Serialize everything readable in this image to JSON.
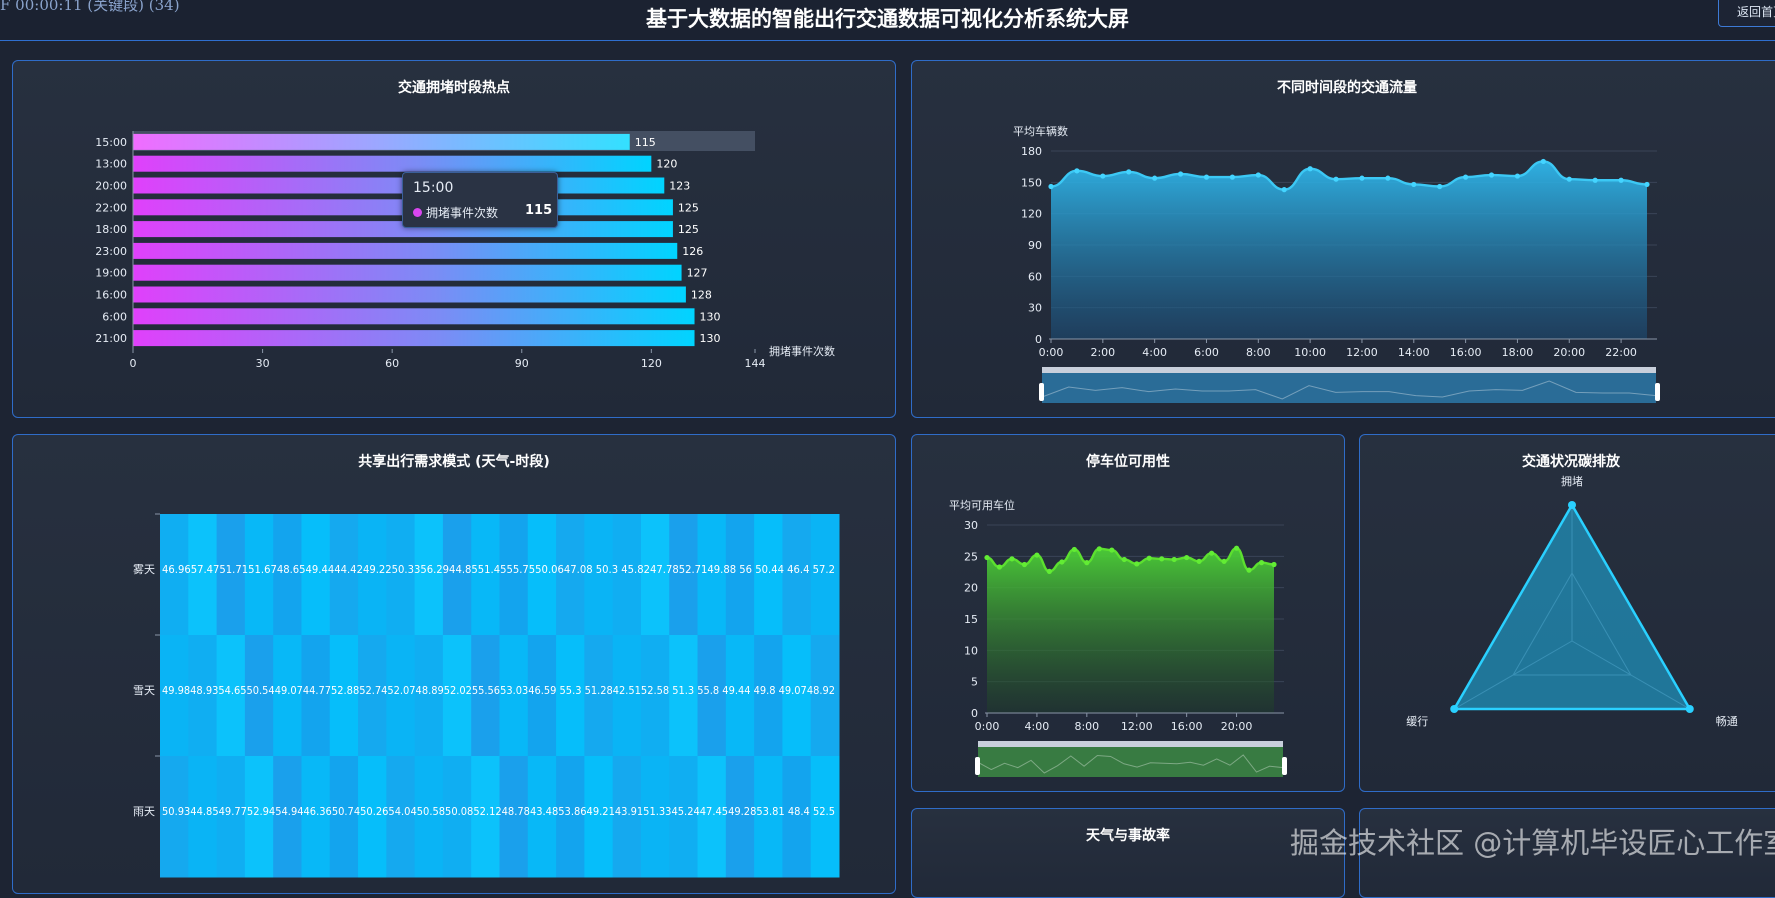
{
  "header": {
    "clock": "F 00:00:11 (关键段) (34)",
    "title": "基于大数据的智能出行交通数据可视化分析系统大屏",
    "back_label": "返回首页"
  },
  "panels": {
    "congestion": "交通拥堵时段热点",
    "flow": "不同时间段的交通流量",
    "sharing": "共享出行需求模式 (天气-时段)",
    "parking": "停车位可用性",
    "emission": "交通状况碳排放",
    "weather": "天气与事故率"
  },
  "tooltip": {
    "time": "15:00",
    "label": "拥堵事件次数",
    "value": "115"
  },
  "watermark": "掘金技术社区 @计算机毕设匠心工作室",
  "chart_data": [
    {
      "id": "congestion",
      "type": "bar",
      "title": "交通拥堵时段热点",
      "orientation": "horizontal",
      "categories": [
        "15:00",
        "13:00",
        "20:00",
        "22:00",
        "18:00",
        "23:00",
        "19:00",
        "16:00",
        "6:00",
        "21:00"
      ],
      "values": [
        115,
        120,
        123,
        125,
        125,
        126,
        127,
        128,
        130,
        130
      ],
      "xlabel": "拥堵事件次数",
      "xlim": [
        0,
        144
      ],
      "xticks": [
        0,
        30,
        60,
        90,
        120,
        144
      ],
      "colors": [
        "#e040fb",
        "#00d4ff"
      ]
    },
    {
      "id": "flow",
      "type": "area",
      "title": "不同时间段的交通流量",
      "ylabel": "平均车辆数",
      "ylim": [
        0,
        180
      ],
      "yticks": [
        0,
        30,
        60,
        90,
        120,
        150,
        180
      ],
      "x_ticks": [
        "0:00",
        "2:00",
        "4:00",
        "6:00",
        "8:00",
        "10:00",
        "12:00",
        "14:00",
        "16:00",
        "18:00",
        "20:00",
        "22:00"
      ],
      "x": [
        "0:00",
        "1:00",
        "2:00",
        "3:00",
        "4:00",
        "5:00",
        "6:00",
        "7:00",
        "8:00",
        "9:00",
        "10:00",
        "11:00",
        "12:00",
        "13:00",
        "14:00",
        "15:00",
        "16:00",
        "17:00",
        "18:00",
        "19:00",
        "20:00",
        "21:00",
        "22:00",
        "23:00"
      ],
      "values": [
        146,
        161,
        156,
        160,
        154,
        158,
        155,
        155,
        157,
        143,
        163,
        153,
        154,
        154,
        148,
        146,
        155,
        157,
        156,
        170,
        153,
        152,
        152,
        148
      ],
      "color": "#2fb6ea"
    },
    {
      "id": "sharing",
      "type": "heatmap",
      "title": "共享出行需求模式 (天气-时段)",
      "rows": [
        {
          "name": "雾天",
          "label": "46.9657.4751.7151.6748.6549.4444.4249.2250.3356.2944.8551.4555.7550.0647.08 50.3 45.8247.7852.7149.88   56   50.44 46.4  57.2"
        },
        {
          "name": "雪天",
          "label": "49.9848.9354.6550.5449.0744.7752.8852.7452.0748.8952.0255.5653.0346.59 55.3  51.2842.5152.58 51.3   55.8 49.44 49.8 49.0748.92"
        },
        {
          "name": "雨天",
          "label": "50.9344.8549.7752.9454.9446.3650.7450.2654.0450.5850.0852.1248.7843.4853.8649.2143.9151.3345.2447.4549.2853.81 48.4   52.5"
        }
      ]
    },
    {
      "id": "parking",
      "type": "area",
      "title": "停车位可用性",
      "ylabel": "平均可用车位",
      "ylim": [
        0,
        30
      ],
      "yticks": [
        0,
        5,
        10,
        15,
        20,
        25,
        30
      ],
      "x_ticks": [
        "0:00",
        "4:00",
        "8:00",
        "12:00",
        "16:00",
        "20:00"
      ],
      "x": [
        "0:00",
        "1:00",
        "2:00",
        "3:00",
        "4:00",
        "5:00",
        "6:00",
        "7:00",
        "8:00",
        "9:00",
        "10:00",
        "11:00",
        "12:00",
        "13:00",
        "14:00",
        "15:00",
        "16:00",
        "17:00",
        "18:00",
        "19:00",
        "20:00",
        "21:00",
        "22:00",
        "23:00"
      ],
      "values": [
        24.8,
        23.3,
        24.6,
        23.7,
        25.2,
        22.6,
        24.1,
        26.1,
        24.0,
        26.2,
        26.0,
        24.5,
        23.8,
        24.7,
        24.6,
        24.5,
        24.8,
        24.2,
        25.5,
        24.2,
        26.3,
        22.8,
        24.0,
        23.7
      ],
      "color": "#4cd137"
    },
    {
      "id": "emission",
      "type": "radar",
      "title": "交通状况碳排放",
      "indicators": [
        "拥堵",
        "畅通",
        "缓行"
      ],
      "values": [
        1.0,
        1.0,
        1.0
      ]
    }
  ]
}
